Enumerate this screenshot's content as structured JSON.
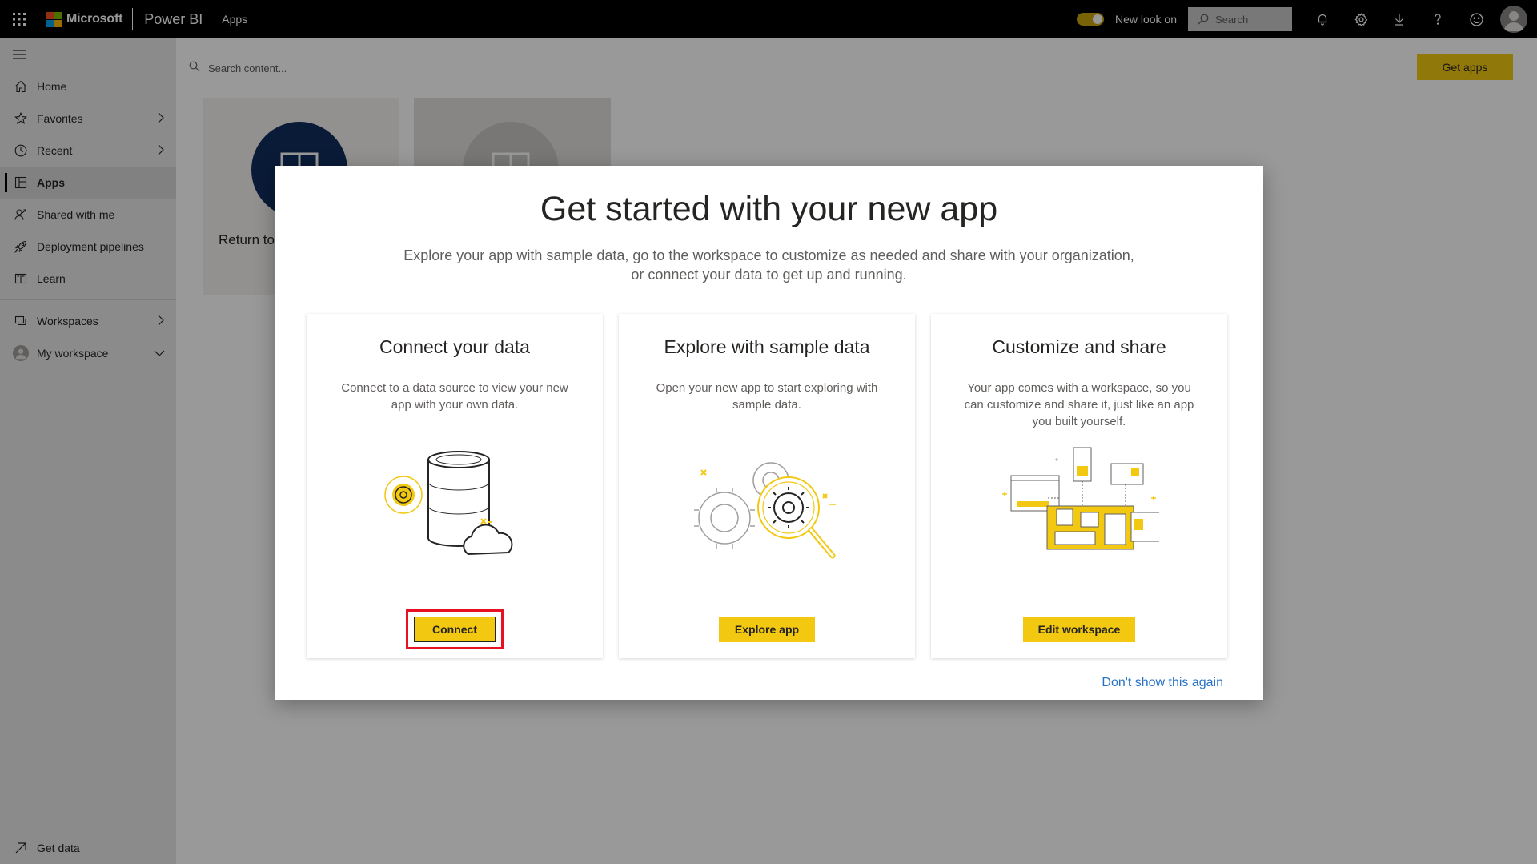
{
  "topbar": {
    "brand": "Microsoft",
    "product": "Power BI",
    "breadcrumb": "Apps",
    "new_look_label": "New look on",
    "search_placeholder": "Search",
    "brand_colors": [
      "#f25022",
      "#7fba00",
      "#00a4ef",
      "#ffb900"
    ]
  },
  "sidebar": {
    "items": [
      {
        "label": "Home",
        "icon": "home-icon"
      },
      {
        "label": "Favorites",
        "icon": "star-icon"
      },
      {
        "label": "Recent",
        "icon": "clock-icon"
      },
      {
        "label": "Apps",
        "icon": "apps-icon"
      },
      {
        "label": "Shared with me",
        "icon": "shared-icon"
      },
      {
        "label": "Deployment pipelines",
        "icon": "rocket-icon"
      },
      {
        "label": "Learn",
        "icon": "book-icon"
      },
      {
        "label": "Workspaces",
        "icon": "workspaces-icon"
      },
      {
        "label": "My workspace",
        "icon": "avatar-icon"
      }
    ],
    "get_data": "Get data"
  },
  "main": {
    "search_placeholder": "Search content...",
    "get_apps": "Get apps",
    "tiles": [
      {
        "label": "Return to",
        "color": "#0f2d5c"
      },
      {
        "label": "",
        "color": "#c8c6c4"
      }
    ]
  },
  "dialog": {
    "title": "Get started with your new app",
    "subtitle_line1": "Explore your app with sample data, go to the workspace to customize as needed and share with your organization,",
    "subtitle_line2": "or connect your data to get up and running.",
    "cards": [
      {
        "title": "Connect your data",
        "desc": "Connect to a data source to view your new app with your own data.",
        "button": "Connect"
      },
      {
        "title": "Explore with sample data",
        "desc": "Open your new app to start exploring with sample data.",
        "button": "Explore app"
      },
      {
        "title": "Customize and share",
        "desc": "Your app comes with a workspace, so you can customize and share it, just like an app you built yourself.",
        "button": "Edit workspace"
      }
    ],
    "dont_show": "Don't show this again",
    "accent": "#f2c811",
    "highlight": "#e81123"
  }
}
